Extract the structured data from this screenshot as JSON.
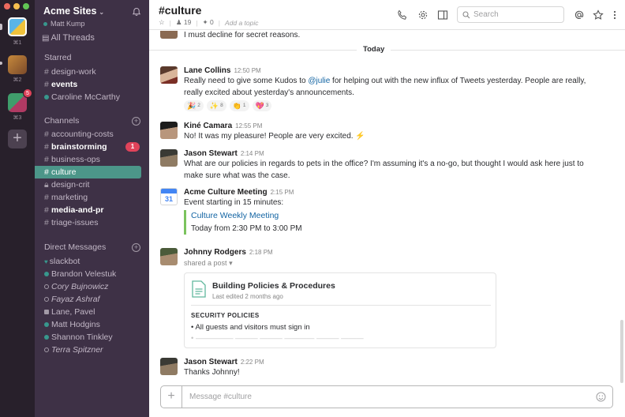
{
  "workspaces": [
    {
      "label": "⌘1"
    },
    {
      "label": "⌘2"
    },
    {
      "label": "⌘3",
      "badge": "5"
    }
  ],
  "team": {
    "name": "Acme Sites",
    "user": "Matt Kump"
  },
  "sidebar": {
    "all_threads": "All Threads",
    "starred_heading": "Starred",
    "starred": [
      "design-work",
      "events",
      "Caroline McCarthy"
    ],
    "channels_heading": "Channels",
    "channels": [
      {
        "name": "accounting-costs"
      },
      {
        "name": "brainstorming",
        "badge": "1"
      },
      {
        "name": "business-ops"
      },
      {
        "name": "culture"
      },
      {
        "name": "design-crit"
      },
      {
        "name": "marketing"
      },
      {
        "name": "media-and-pr"
      },
      {
        "name": "triage-issues"
      }
    ],
    "dm_heading": "Direct Messages",
    "dms": [
      "slackbot",
      "Brandon Velestuk",
      "Cory Bujnowicz",
      "Fayaz Ashraf",
      "Lane, Pavel",
      "Matt Hodgins",
      "Shannon Tinkley",
      "Terra Spitzner"
    ]
  },
  "header": {
    "title": "#culture",
    "members": "19",
    "pins": "0",
    "topic": "Add a topic",
    "search_placeholder": "Search"
  },
  "messages": {
    "prev_text": "I must decline for secret reasons.",
    "day_divider": "Today",
    "m1": {
      "author": "Lane Collins",
      "time": "12:50 PM",
      "text_before": "Really need to give some Kudos to ",
      "mention": "@julie",
      "text_after": " for helping out with the new influx of Tweets yesterday. People are really, really excited about yesterday's announcements.",
      "reactions": [
        {
          "emoji": "🎉",
          "count": "2"
        },
        {
          "emoji": "✨",
          "count": "8"
        },
        {
          "emoji": "👏",
          "count": "1"
        },
        {
          "emoji": "💖",
          "count": "3"
        }
      ]
    },
    "m2": {
      "author": "Kiné Camara",
      "time": "12:55 PM",
      "text": "No! It was my pleasure! People are very excited. ⚡"
    },
    "m3": {
      "author": "Jason Stewart",
      "time": "2:14 PM",
      "text": "What are our policies in regards to pets in the office? I'm assuming it's a no-go, but thought I would ask here just to make sure what was the case."
    },
    "m4": {
      "author": "Acme Culture Meeting",
      "time": "2:15 PM",
      "text": "Event starting in 15 minutes:",
      "calendar_day": "31",
      "event_title": "Culture Weekly Meeting",
      "event_time": "Today from 2:30 PM to 3:00 PM"
    },
    "m5": {
      "author": "Johnny Rodgers",
      "time": "2:18 PM",
      "shared": "shared a post",
      "post_title": "Building Policies & Procedures",
      "post_edited": "Last edited 2 months ago",
      "post_section": "SECURITY POLICIES",
      "post_item": "All guests and visitors must sign in"
    },
    "m6": {
      "author": "Jason Stewart",
      "time": "2:22 PM",
      "text": "Thanks Johnny!"
    }
  },
  "composer": {
    "placeholder": "Message #culture"
  },
  "colors": {
    "sidebar": "#3e3146",
    "rail": "#28202b",
    "active_channel": "#4c9689",
    "badge": "#e0435a",
    "link": "#1264a3",
    "event_bar": "#7bc35e"
  }
}
